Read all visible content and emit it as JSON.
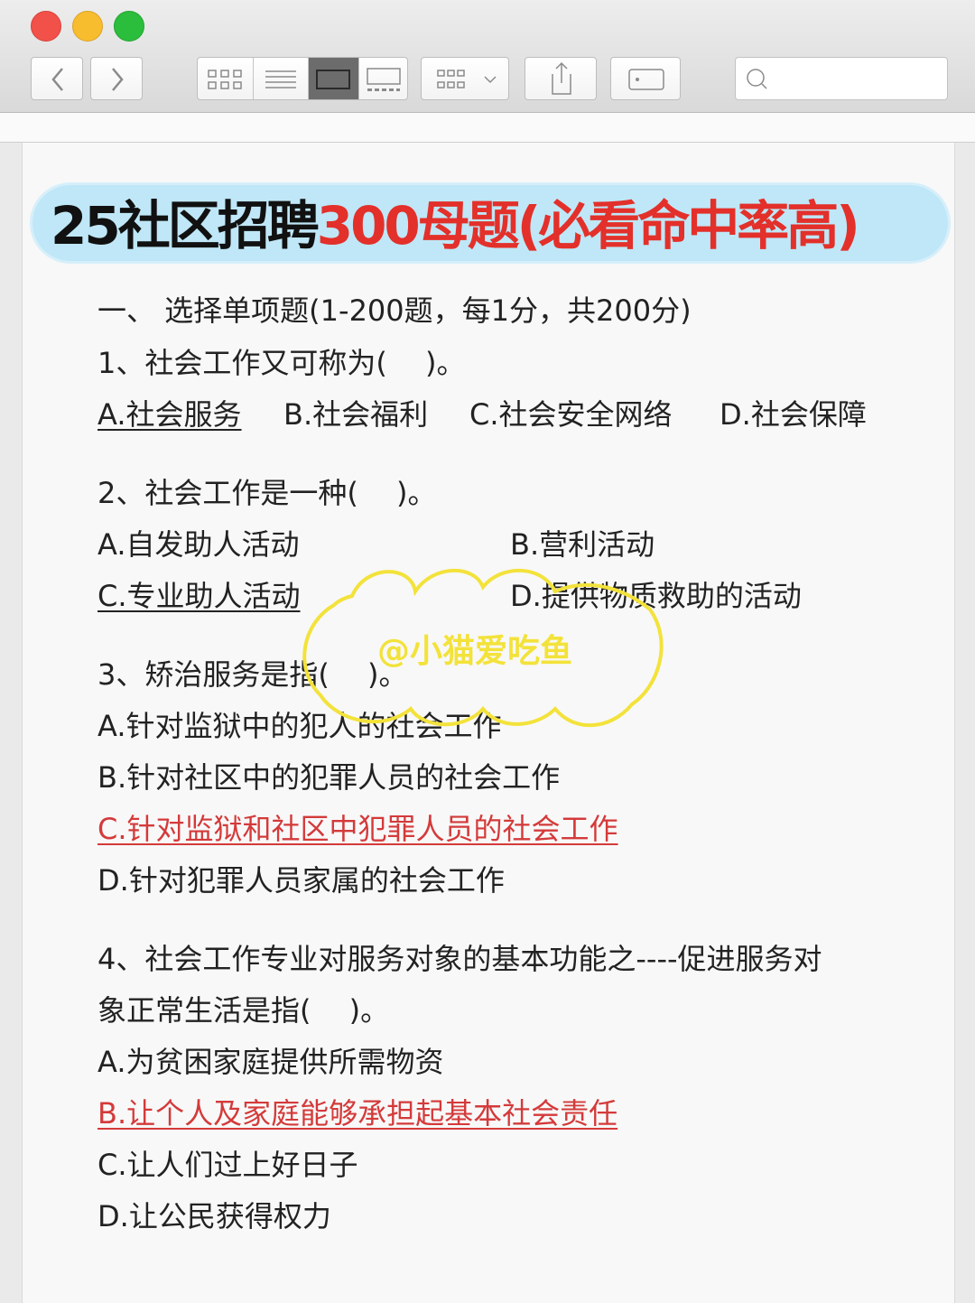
{
  "window": {
    "colors": {
      "close": "#f2514a",
      "minimize": "#f7bd2f",
      "zoom": "#2bbd3c"
    },
    "toolbar_icons": [
      "back-icon",
      "forward-icon",
      "icon-view-icon",
      "list-view-icon",
      "cover-flow-icon",
      "gallery-view-icon",
      "group-icon",
      "share-icon",
      "tag-icon",
      "search-icon"
    ]
  },
  "document": {
    "title_black": "25社区招聘",
    "title_red": "300母题(必看命中率高)",
    "section_header": "一、 选择单项题(1-200题，每1分，共200分)",
    "q1": {
      "question": "1、社会工作又可称为(　 )。",
      "a": "A.社会服务",
      "b": "B.社会福利",
      "c": "C.社会安全网络",
      "d": "D.社会保障"
    },
    "q2": {
      "question": "2、社会工作是一种(　 )。",
      "a": "A.自发助人活动",
      "b": "B.营利活动",
      "c": "C.专业助人活动",
      "d": "D.提供物质救助的活动"
    },
    "q3": {
      "question": "3、矫治服务是指(　 )。",
      "a": "A.针对监狱中的犯人的社会工作",
      "b": "B.针对社区中的犯罪人员的社会工作",
      "c": "C.针对监狱和社区中犯罪人员的社会工作",
      "d": "D.针对犯罪人员家属的社会工作"
    },
    "q4": {
      "question_line1": "4、社会工作专业对服务对象的基本功能之----促进服务对",
      "question_line2": "象正常生活是指(　 )。",
      "a": "A.为贫困家庭提供所需物资",
      "b": "B.让个人及家庭能够承担起基本社会责任",
      "c": "C.让人们过上好日子",
      "d": "D.让公民获得权力"
    },
    "answer_color": "#d43a3a"
  },
  "watermark": {
    "text": "@小猫爱吃鱼",
    "color": "#f3e23a"
  }
}
